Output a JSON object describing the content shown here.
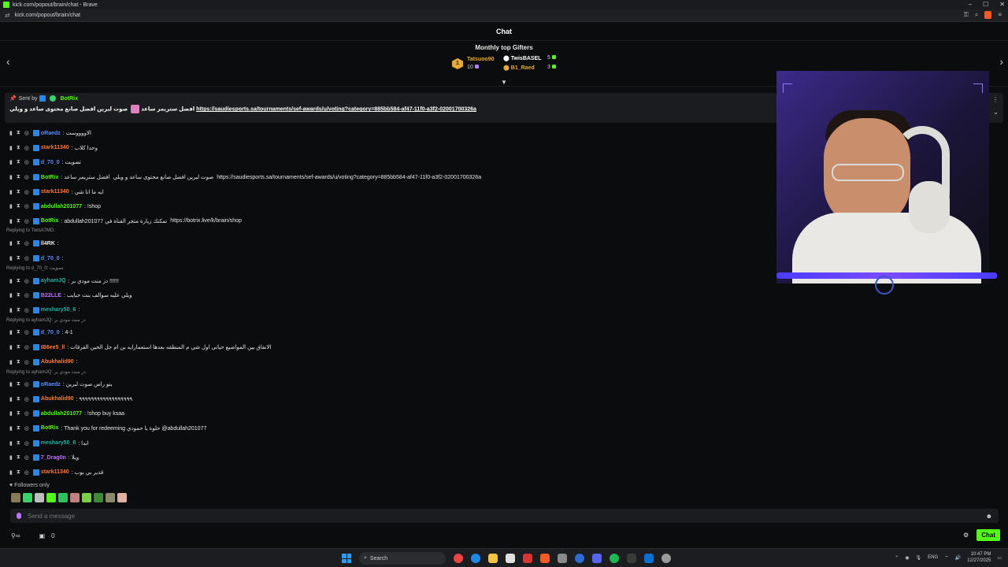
{
  "browser": {
    "window_title": "kick.com/popout/brain/chat - Brave",
    "url": "kick.com/popout/brain/chat"
  },
  "header": {
    "title": "Chat"
  },
  "top_gifters": {
    "title": "Monthly top Gifters",
    "rank1": {
      "name": "Tatsuoo90",
      "count": "10"
    },
    "rank2": {
      "name": "TwisBASEL",
      "count": "5"
    },
    "rank3": {
      "name": "B1_Raed",
      "count": "3"
    }
  },
  "pinned": {
    "sent_by_label": "Sent by",
    "sender": "BotRix",
    "text_prefix": "صوت لبرين افضل صانع محتوى ساعد و ويلي",
    "text_suffix": "افضل ستريمر ساعد",
    "link": "https://saudiesports.sa/tournaments/sef-awards/u/voting?category=885bb584-af47-11f0-a3f2-02001700326a"
  },
  "messages": [
    {
      "user": "oRaedz",
      "color": "#5b8cff",
      "text": ": الاووووست"
    },
    {
      "user": "stark11340",
      "color": "#ff7a3c",
      "text": ": وحدا كلاب"
    },
    {
      "user": "d_70_0",
      "color": "#5b8cff",
      "text": ": تصويت"
    },
    {
      "user": "BotRix",
      "color": "#53fc18",
      "text": ": افضل ستريمر ساعد",
      "link": "https://saudiesports.sa/tournaments/sef-awards/u/voting?category=885bb584-af47-11f0-a3f2-02001700326a",
      "link_prefix": "صوت لبرين افضل صانع محتوى ساعد و ويلي"
    },
    {
      "user": "stark11340",
      "color": "#ff7a3c",
      "text": ": ايه ما انا شي"
    },
    {
      "user": "abdullah201077",
      "color": "#53fc18",
      "text": ": !shop"
    },
    {
      "user": "BotRix",
      "color": "#53fc18",
      "text": ": abdullah201077 تمكنك زيارة متجر القناة في",
      "link": "https://botrix.live/k/brain/shop"
    },
    {
      "reply": "Replying to TwisA7MD:"
    },
    {
      "user": "ll4RK",
      "color": "#e9e9e9",
      "text": ":"
    },
    {
      "user": "d_70_0",
      "color": "#5b8cff",
      "text": ":"
    },
    {
      "reply": "Replying to d_70_0: تصويت"
    },
    {
      "user": "ayhamJQ",
      "color": "#27b0a4",
      "text": ": دز منت مودي بر !!!!!!"
    },
    {
      "user": "B22LLE",
      "color": "#c070ff",
      "text": ": ويلي عليه سوالف بنت حبايب"
    },
    {
      "user": "meshary50_6",
      "color": "#27b0a4",
      "text": ":"
    },
    {
      "reply": "Replying to ayhamJQ: دز منت مودي بر"
    },
    {
      "user": "d_70_0",
      "color": "#5b8cff",
      "text": ": 4-1"
    },
    {
      "user": "IB6ee5_ll",
      "color": "#ff7a3c",
      "text": ": الانفاق بين المواضيع حياتي اول شي م المنطقه بعدها استعمارايه بن ام جل الحين الفرقات"
    },
    {
      "user": "Abukhalid90",
      "color": "#ff7a3c",
      "text": ":"
    },
    {
      "reply": "Replying to ayhamJQ: دز منت مودي بر"
    },
    {
      "user": "oRaedz",
      "color": "#5b8cff",
      "text": ": بنو راس صوت لبرين"
    },
    {
      "user": "Abukhalid90",
      "color": "#ff7a3c",
      "text": ": ٩٩٩٩٩٩٩٩٩٩٩٩٩٩٩٩٩٩"
    },
    {
      "user": "abdullah201077",
      "color": "#53fc18",
      "text": ": !shop buy ksaa"
    },
    {
      "user": "BotRix",
      "color": "#53fc18",
      "text": ": Thank you for redeeming حلوة يا حمودي @abdullah201077"
    },
    {
      "user": "meshary50_6",
      "color": "#27b0a4",
      "text": ": ابدا"
    },
    {
      "user": "7_Drag0n",
      "color": "#c070ff",
      "text": ": ويلا"
    },
    {
      "user": "stark11340",
      "color": "#ff7a3c",
      "text": ": قدير بي بوب"
    }
  ],
  "chat_mode": "Followers only",
  "input": {
    "placeholder": "Send a message"
  },
  "bottom": {
    "points": "0",
    "chat_button": "Chat"
  },
  "taskbar": {
    "search_label": "Search",
    "lang": "ENG",
    "time": "10:47 PM",
    "date": "12/27/2025"
  },
  "colors": {
    "accent": "#53fc18",
    "background": "#0b0c0d"
  }
}
